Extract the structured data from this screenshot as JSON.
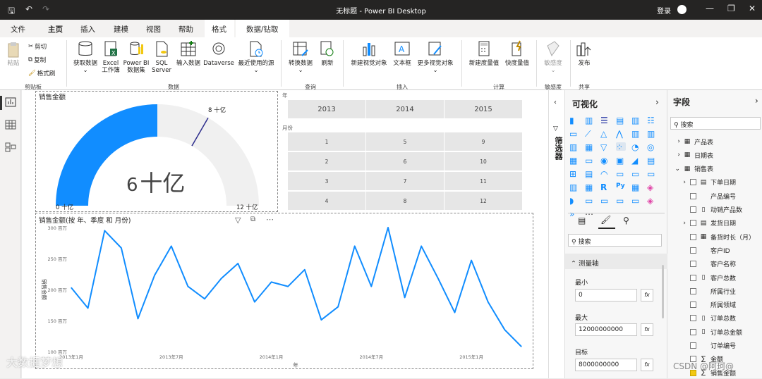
{
  "window": {
    "title": "无标题 - Power BI Desktop",
    "signin": "登录"
  },
  "tabs": [
    "文件",
    "主页",
    "插入",
    "建模",
    "视图",
    "帮助",
    "格式",
    "数据/钻取"
  ],
  "ribbon": {
    "clipboard": {
      "paste": "粘贴",
      "cut": "剪切",
      "copy": "复制",
      "format_painter": "格式刷",
      "group": "剪贴板"
    },
    "data": {
      "get_data": "获取数据",
      "excel": "Excel 工作簿",
      "powerbi": "Power BI 数据集",
      "sql": "SQL Server",
      "enter": "输入数据",
      "dataverse": "Dataverse",
      "recent": "最近使用的源",
      "group": "数据"
    },
    "query": {
      "transform": "转换数据",
      "refresh": "刷新",
      "group": "查询"
    },
    "insert": {
      "new_visual": "新建视觉对象",
      "textbox": "文本框",
      "more": "更多视觉对象",
      "group": "插入"
    },
    "calc": {
      "new_measure": "新建度量值",
      "quick_measure": "快度量值",
      "group": "计算"
    },
    "sensitivity": {
      "label": "敏感度",
      "group": "敏感度"
    },
    "share": {
      "publish": "发布",
      "group": "共享"
    }
  },
  "gauge": {
    "title": "销售金额",
    "value_text": "6 十亿",
    "value_num": "6",
    "value_unit": "十亿",
    "min_label": "0 十亿",
    "max_label": "12 十亿",
    "target_label": "8 十亿",
    "value": 6000000000,
    "min": 0,
    "max": 12000000000,
    "target": 8000000000,
    "fill_color": "#118dff",
    "track_color": "#f0f0f0"
  },
  "matrix": {
    "year_header": "年",
    "month_header": "月份",
    "years": [
      "2013",
      "2014",
      "2015"
    ],
    "months": [
      [
        "1",
        "5",
        "9"
      ],
      [
        "2",
        "6",
        "10"
      ],
      [
        "3",
        "7",
        "11"
      ],
      [
        "4",
        "8",
        "12"
      ]
    ]
  },
  "line": {
    "title": "销售金额(按 年、季度 和 月份)",
    "y_axis_label": "销售金额",
    "x_axis_label": "年",
    "y_ticks": [
      "300 百万",
      "250 百万",
      "200 百万",
      "150 百万",
      "100 百万"
    ],
    "x_ticks": [
      "2013年1月",
      "2013年7月",
      "2014年1月",
      "2014年7月",
      "2015年1月"
    ],
    "color": "#118dff"
  },
  "chart_data": {
    "type": "line",
    "title": "销售金额(按 年、季度 和 月份)",
    "xlabel": "年",
    "ylabel": "销售金额",
    "ylim": [
      100,
      300
    ],
    "y_unit": "百万",
    "x": [
      "2013-01",
      "2013-02",
      "2013-03",
      "2013-04",
      "2013-05",
      "2013-06",
      "2013-07",
      "2013-08",
      "2013-09",
      "2013-10",
      "2013-11",
      "2013-12",
      "2014-01",
      "2014-02",
      "2014-03",
      "2014-04",
      "2014-05",
      "2014-06",
      "2014-07",
      "2014-08",
      "2014-09",
      "2014-10",
      "2014-11",
      "2014-12",
      "2015-01",
      "2015-02",
      "2015-03",
      "2015-04"
    ],
    "series": [
      {
        "values": [
          203,
          170,
          295,
          267,
          153,
          223,
          270,
          205,
          185,
          218,
          242,
          180,
          212,
          205,
          232,
          151,
          172,
          270,
          205,
          300,
          187,
          270,
          218,
          163,
          247,
          180,
          135,
          108
        ]
      }
    ]
  },
  "filters_panel": {
    "label": "筛选器"
  },
  "viz_panel": {
    "title": "可视化",
    "search_placeholder": "搜索",
    "section": "测量轴",
    "min_label": "最小",
    "min_value": "0",
    "max_label": "最大",
    "max_value": "12000000000",
    "target_label": "目标",
    "target_value": "8000000000",
    "fx": "fx",
    "more": "···"
  },
  "fields_panel": {
    "title": "字段",
    "search_placeholder": "搜索",
    "items": [
      {
        "name": "产品表",
        "type": "table"
      },
      {
        "name": "日期表",
        "type": "table"
      },
      {
        "name": "销售表",
        "type": "table-checked"
      },
      {
        "name": "下单日期",
        "type": "date"
      },
      {
        "name": "产品编号",
        "type": "field"
      },
      {
        "name": "动销产品数",
        "type": "measure"
      },
      {
        "name": "发货日期",
        "type": "date"
      },
      {
        "name": "备货时长（月）",
        "type": "column"
      },
      {
        "name": "客户ID",
        "type": "field"
      },
      {
        "name": "客户名称",
        "type": "field"
      },
      {
        "name": "客户总数",
        "type": "measure"
      },
      {
        "name": "所属行业",
        "type": "field"
      },
      {
        "name": "所属领域",
        "type": "field"
      },
      {
        "name": "订单总数",
        "type": "measure"
      },
      {
        "name": "订单总金额",
        "type": "measure"
      },
      {
        "name": "订单编号",
        "type": "field"
      },
      {
        "name": "金额",
        "type": "sum"
      },
      {
        "name": "销售金额",
        "type": "sum-checked"
      }
    ]
  },
  "watermarks": {
    "left": "大数据梦想",
    "right": "CSDN @阿珂@"
  }
}
